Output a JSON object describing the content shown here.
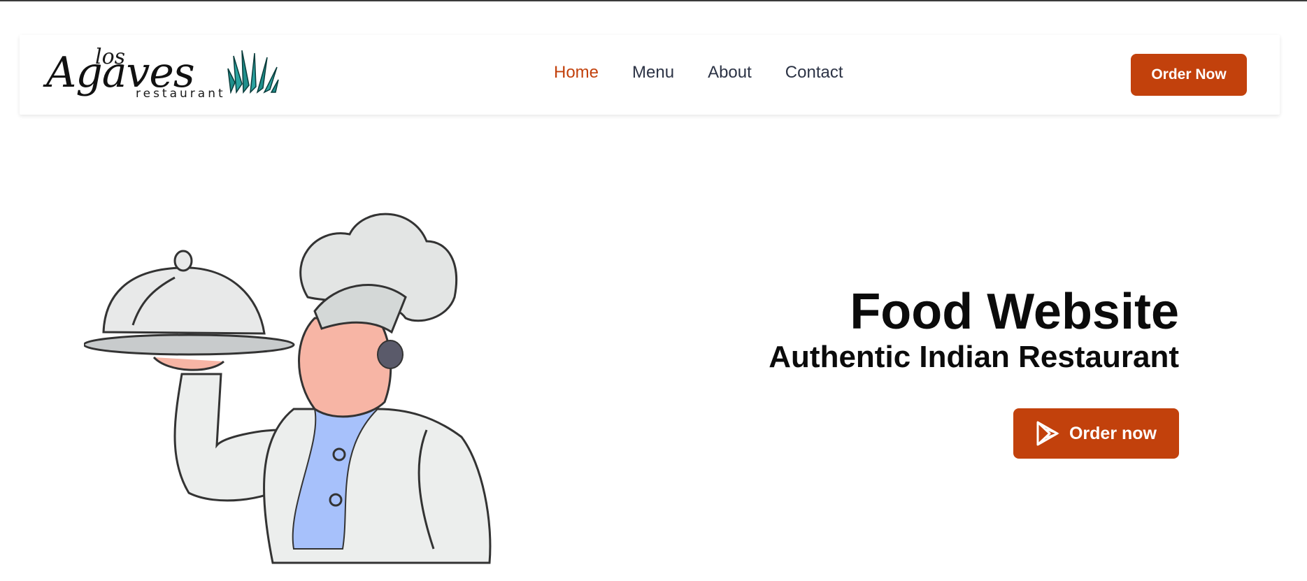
{
  "brand": {
    "logo_top": "los",
    "logo_main": "Agaves",
    "logo_sub": "restaurant"
  },
  "nav": {
    "items": [
      {
        "label": "Home",
        "active": true
      },
      {
        "label": "Menu",
        "active": false
      },
      {
        "label": "About",
        "active": false
      },
      {
        "label": "Contact",
        "active": false
      }
    ],
    "cta_label": "Order Now"
  },
  "hero": {
    "title": "Food Website",
    "subtitle": "Authentic Indian Restaurant",
    "cta_label": "Order now",
    "cta_icon": "play-store-icon",
    "illustration": "chef-holding-cloche-illustration"
  },
  "colors": {
    "accent": "#c2410c",
    "nav_text": "#2d3446",
    "heading": "#0b0b0b",
    "logo_grass": "#1f8f8c"
  }
}
